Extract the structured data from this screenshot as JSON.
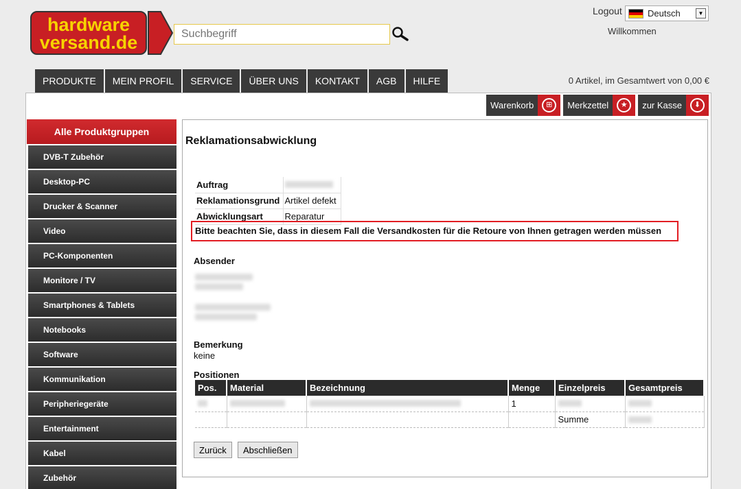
{
  "header": {
    "logo_line1": "hardware",
    "logo_line2": "versand.de",
    "search_placeholder": "Suchbegriff",
    "logout": "Logout",
    "language": "Deutsch",
    "welcome": "Willkommen"
  },
  "nav": [
    "PRODUKTE",
    "MEIN PROFIL",
    "SERVICE",
    "ÜBER UNS",
    "KONTAKT",
    "AGB",
    "HILFE"
  ],
  "cart_summary": "0 Artikel, im Gesamtwert von 0,00 €",
  "actions": {
    "cart": "Warenkorb",
    "wishlist": "Merkzettel",
    "checkout": "zur Kasse"
  },
  "sidebar": {
    "head": "Alle Produktgruppen",
    "items": [
      "DVB-T Zubehör",
      "Desktop-PC",
      "Drucker & Scanner",
      "Video",
      "PC-Komponenten",
      "Monitore / TV",
      "Smartphones & Tablets",
      "Notebooks",
      "Software",
      "Kommunikation",
      "Peripheriegeräte",
      "Entertainment",
      "Kabel",
      "Zubehör"
    ]
  },
  "main": {
    "title": "Reklamationsabwicklung",
    "info": {
      "order_label": "Auftrag",
      "reason_label": "Reklamationsgrund",
      "reason_value": "Artikel defekt",
      "type_label": "Abwicklungsart",
      "type_value": "Reparatur"
    },
    "notice": "Bitte beachten Sie, dass in diesem Fall die Versandkosten für die Retoure von Ihnen getragen werden müssen",
    "sender_label": "Absender",
    "remark_label": "Bemerkung",
    "remark_value": "keine",
    "positions_label": "Positionen",
    "columns": [
      "Pos.",
      "Material",
      "Bezeichnung",
      "Menge",
      "Einzelpreis",
      "Gesamtpreis"
    ],
    "row_qty": "1",
    "sum_label": "Summe",
    "back_button": "Zurück",
    "finish_button": "Abschließen"
  },
  "colors": {
    "brand_red": "#c81f24",
    "nav_dark": "#3a3a3a",
    "logo_yellow": "#f7d300"
  }
}
